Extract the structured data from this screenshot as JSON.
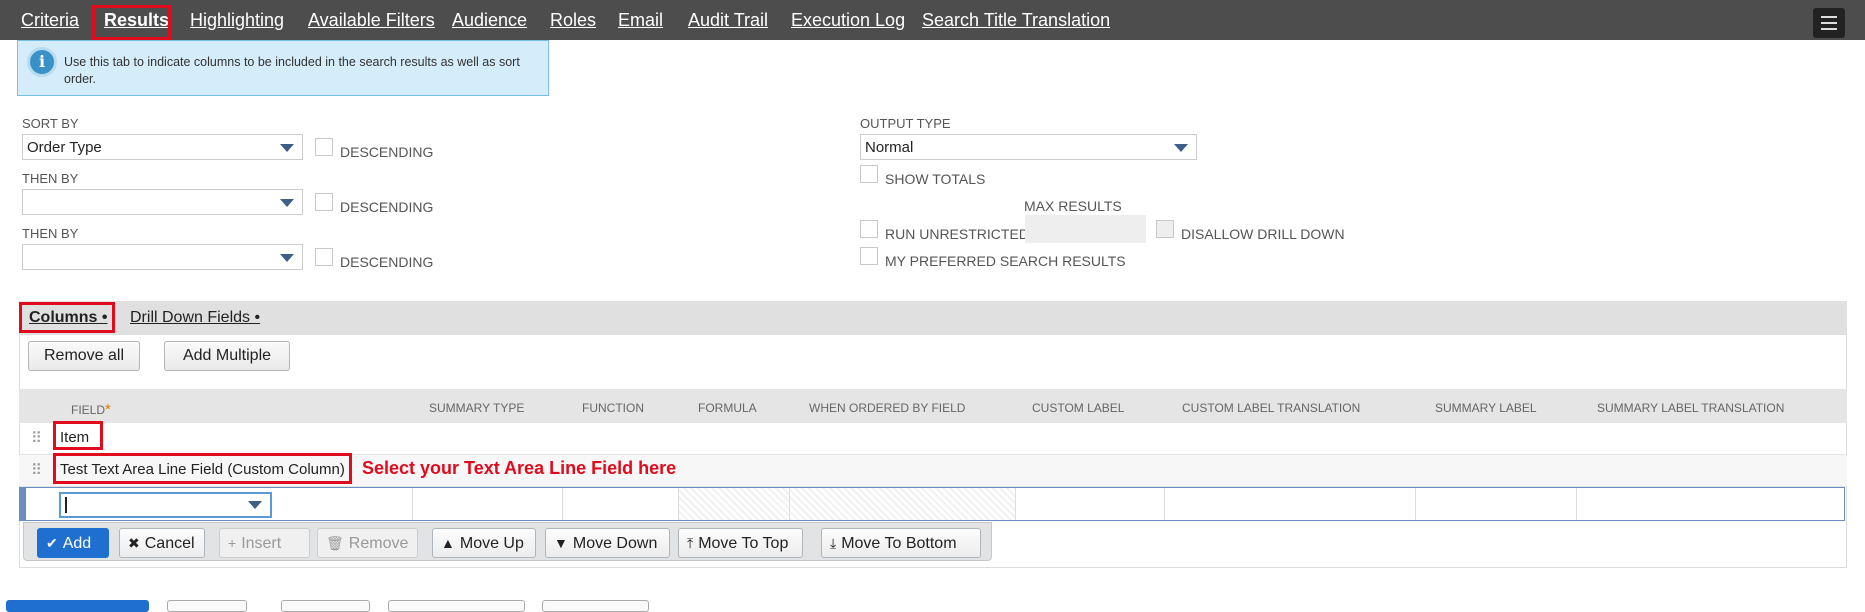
{
  "tabs": [
    {
      "label": "Criteria",
      "active": false
    },
    {
      "label": "Results",
      "active": true
    },
    {
      "label": "Highlighting",
      "active": false
    },
    {
      "label": "Available Filters",
      "active": false
    },
    {
      "label": "Audience",
      "active": false
    },
    {
      "label": "Roles",
      "active": false
    },
    {
      "label": "Email",
      "active": false
    },
    {
      "label": "Audit Trail",
      "active": false
    },
    {
      "label": "Execution Log",
      "active": false
    },
    {
      "label": "Search Title Translation",
      "active": false
    }
  ],
  "info": {
    "text": "Use this tab to indicate columns to be included in the search results as well as sort order."
  },
  "sort": {
    "sort_by_label": "SORT BY",
    "sort_by_value": "Order Type",
    "then_by_label": "THEN BY",
    "then_by_value_1": "",
    "then_by_value_2": "",
    "descending_label": "DESCENDING"
  },
  "output": {
    "output_type_label": "OUTPUT TYPE",
    "output_type_value": "Normal",
    "show_totals": "SHOW TOTALS",
    "max_results": "MAX RESULTS",
    "run_unrestricted": "RUN UNRESTRICTED",
    "disallow_drill_down": "DISALLOW DRILL DOWN",
    "my_preferred": "MY PREFERRED SEARCH RESULTS"
  },
  "subtabs": [
    {
      "label": "Columns •",
      "active": true
    },
    {
      "label": "Drill Down Fields •",
      "active": false
    }
  ],
  "list_buttons": {
    "remove_all": "Remove all",
    "add_multiple": "Add Multiple"
  },
  "columns": {
    "field": "FIELD",
    "required_mark": "*",
    "summary_type": "SUMMARY TYPE",
    "function": "FUNCTION",
    "formula": "FORMULA",
    "when_ordered": "WHEN ORDERED BY FIELD",
    "custom_label": "CUSTOM LABEL",
    "custom_label_translation": "CUSTOM LABEL TRANSLATION",
    "summary_label": "SUMMARY LABEL",
    "summary_label_translation": "SUMMARY LABEL TRANSLATION"
  },
  "rows": [
    {
      "field": "Item"
    },
    {
      "field": "Test Text Area Line Field (Custom Column)"
    }
  ],
  "annotation": "Select your Text Area Line Field here",
  "toolbar": {
    "add": "Add",
    "cancel": "Cancel",
    "insert": "Insert",
    "remove": "Remove",
    "move_up": "Move Up",
    "move_down": "Move Down",
    "move_to_top": "Move To Top",
    "move_to_bottom": "Move To Bottom"
  },
  "colors": {
    "highlight": "#e00b1c",
    "tabbar": "#4d4d4d",
    "primary": "#1f6fd0"
  }
}
